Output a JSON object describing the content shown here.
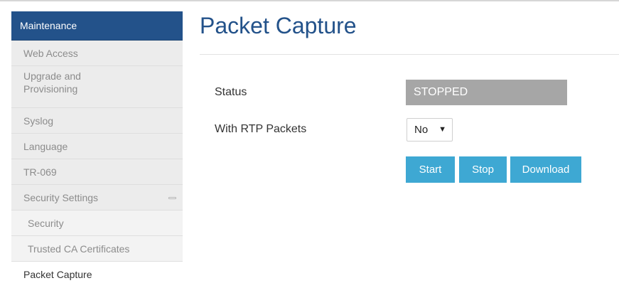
{
  "sidebar": {
    "header": "Maintenance",
    "items": [
      {
        "label": "Web Access"
      },
      {
        "label": "Upgrade and Provisioning"
      },
      {
        "label": "Syslog"
      },
      {
        "label": "Language"
      },
      {
        "label": "TR-069"
      },
      {
        "label": "Security Settings",
        "icon": "collapse-icon"
      },
      {
        "label": "Security"
      },
      {
        "label": "Trusted CA Certificates"
      },
      {
        "label": "Packet Capture"
      }
    ]
  },
  "main": {
    "title": "Packet Capture",
    "status": {
      "label": "Status",
      "value": "STOPPED"
    },
    "rtp": {
      "label": "With RTP Packets",
      "selected": "No",
      "options": [
        "No"
      ]
    },
    "buttons": {
      "start": "Start",
      "stop": "Stop",
      "download": "Download"
    }
  },
  "colors": {
    "header_blue": "#23528a",
    "button_blue": "#3ea8d3",
    "status_gray": "#a6a6a6",
    "sidebar_gray": "#ececec"
  }
}
